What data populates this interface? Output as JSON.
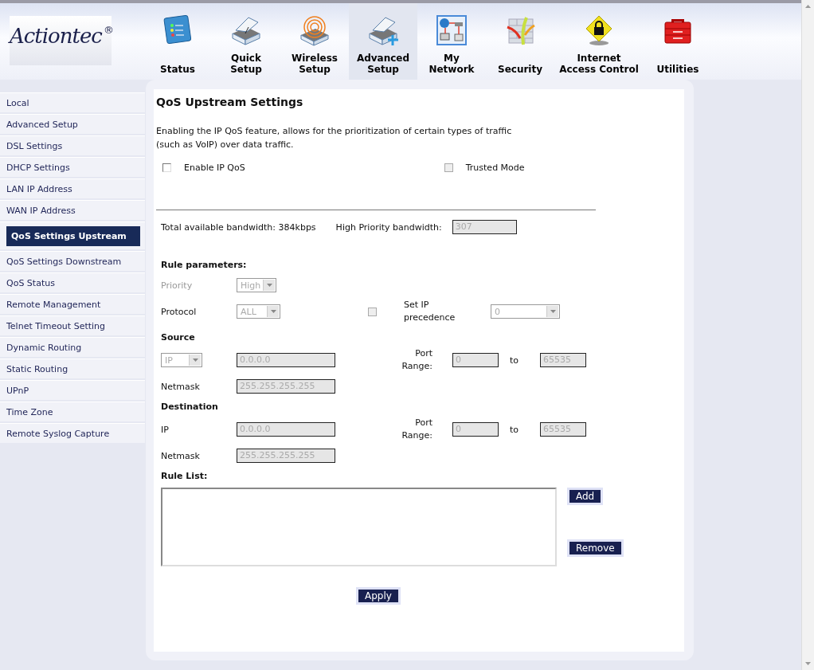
{
  "logo": {
    "name": "Actiontec",
    "mark": "®"
  },
  "nav": [
    {
      "label": "Status",
      "selected": false
    },
    {
      "label": "Quick Setup",
      "selected": false
    },
    {
      "label": "Wireless Setup",
      "selected": false
    },
    {
      "label": "Advanced Setup",
      "selected": true
    },
    {
      "label": "My Network",
      "selected": false
    },
    {
      "label": "Security",
      "selected": false
    },
    {
      "label": "Internet Access Control",
      "selected": false
    },
    {
      "label": "Utilities",
      "selected": false
    }
  ],
  "sidebar": [
    {
      "label": "Local",
      "selected": false
    },
    {
      "label": "Advanced Setup",
      "selected": false
    },
    {
      "label": "DSL Settings",
      "selected": false
    },
    {
      "label": "DHCP Settings",
      "selected": false
    },
    {
      "label": "LAN IP Address",
      "selected": false
    },
    {
      "label": "WAN IP Address",
      "selected": false
    },
    {
      "label": "QoS Settings Upstream",
      "selected": true
    },
    {
      "label": "QoS Settings Downstream",
      "selected": false
    },
    {
      "label": "QoS Status",
      "selected": false
    },
    {
      "label": "Remote Management",
      "selected": false
    },
    {
      "label": "Telnet Timeout Setting",
      "selected": false
    },
    {
      "label": "Dynamic Routing",
      "selected": false
    },
    {
      "label": "Static Routing",
      "selected": false
    },
    {
      "label": "UPnP",
      "selected": false
    },
    {
      "label": "Time Zone",
      "selected": false
    },
    {
      "label": "Remote Syslog Capture",
      "selected": false
    }
  ],
  "content": {
    "title": "QoS Upstream Settings",
    "description": "Enabling the IP QoS feature, allows for the prioritization of certain types of traffic (such as VoIP) over data traffic.",
    "enable_ip_qos": {
      "label": "Enable IP QoS",
      "checked": false,
      "disabled": false
    },
    "trusted_mode": {
      "label": "Trusted Mode",
      "checked": false,
      "disabled": true
    },
    "total_bandwidth": "Total available bandwidth: 384kbps",
    "high_priority": {
      "label": "High Priority bandwidth:",
      "value": "307",
      "disabled": true
    },
    "rule_parameters": {
      "heading": "Rule parameters:",
      "priority": {
        "label": "Priority",
        "value": "High",
        "disabled": true
      },
      "protocol": {
        "label": "Protocol",
        "value": "ALL",
        "disabled": true
      },
      "set_ip_precedence": {
        "label": "Set IP precedence",
        "checked": false,
        "disabled": true,
        "value": "0"
      }
    },
    "source": {
      "heading": "Source",
      "type": {
        "value": "IP",
        "disabled": true
      },
      "ip": {
        "value": "0.0.0.0",
        "disabled": true
      },
      "port_label": "Port Range:",
      "port_from": {
        "value": "0",
        "disabled": true
      },
      "to": "to",
      "port_to": {
        "value": "65535",
        "disabled": true
      },
      "netmask": {
        "label": "Netmask",
        "value": "255.255.255.255",
        "disabled": true
      }
    },
    "destination": {
      "heading": "Destination",
      "ip": {
        "label": "IP",
        "value": "0.0.0.0",
        "disabled": true
      },
      "port_label": "Port Range:",
      "port_from": {
        "value": "0",
        "disabled": true
      },
      "to": "to",
      "port_to": {
        "value": "65535",
        "disabled": true
      },
      "netmask": {
        "label": "Netmask",
        "value": "255.255.255.255",
        "disabled": true
      }
    },
    "rule_list": {
      "heading": "Rule List:",
      "add": "Add",
      "remove": "Remove"
    },
    "apply": "Apply"
  }
}
